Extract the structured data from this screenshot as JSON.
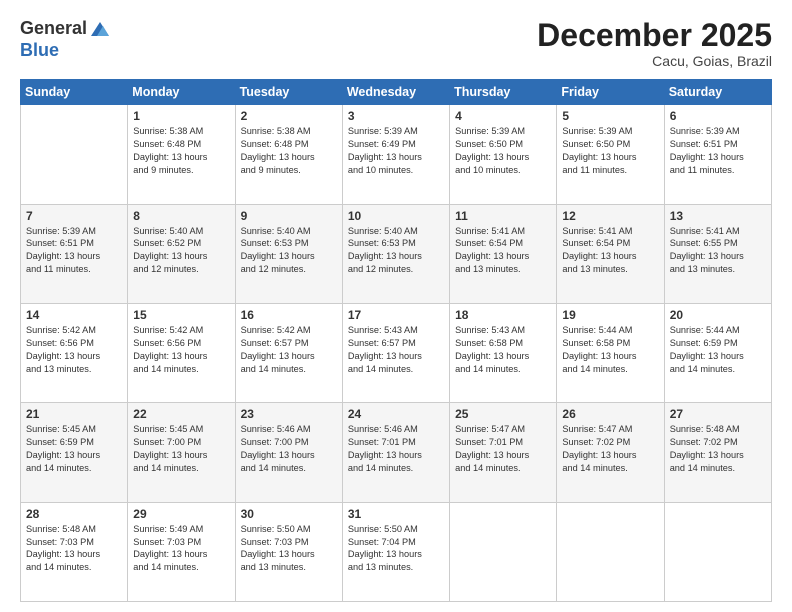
{
  "logo": {
    "general": "General",
    "blue": "Blue"
  },
  "title": "December 2025",
  "location": "Cacu, Goias, Brazil",
  "days_of_week": [
    "Sunday",
    "Monday",
    "Tuesday",
    "Wednesday",
    "Thursday",
    "Friday",
    "Saturday"
  ],
  "weeks": [
    [
      {
        "day": "",
        "info": ""
      },
      {
        "day": "1",
        "info": "Sunrise: 5:38 AM\nSunset: 6:48 PM\nDaylight: 13 hours\nand 9 minutes."
      },
      {
        "day": "2",
        "info": "Sunrise: 5:38 AM\nSunset: 6:48 PM\nDaylight: 13 hours\nand 9 minutes."
      },
      {
        "day": "3",
        "info": "Sunrise: 5:39 AM\nSunset: 6:49 PM\nDaylight: 13 hours\nand 10 minutes."
      },
      {
        "day": "4",
        "info": "Sunrise: 5:39 AM\nSunset: 6:50 PM\nDaylight: 13 hours\nand 10 minutes."
      },
      {
        "day": "5",
        "info": "Sunrise: 5:39 AM\nSunset: 6:50 PM\nDaylight: 13 hours\nand 11 minutes."
      },
      {
        "day": "6",
        "info": "Sunrise: 5:39 AM\nSunset: 6:51 PM\nDaylight: 13 hours\nand 11 minutes."
      }
    ],
    [
      {
        "day": "7",
        "info": "Sunrise: 5:39 AM\nSunset: 6:51 PM\nDaylight: 13 hours\nand 11 minutes."
      },
      {
        "day": "8",
        "info": "Sunrise: 5:40 AM\nSunset: 6:52 PM\nDaylight: 13 hours\nand 12 minutes."
      },
      {
        "day": "9",
        "info": "Sunrise: 5:40 AM\nSunset: 6:53 PM\nDaylight: 13 hours\nand 12 minutes."
      },
      {
        "day": "10",
        "info": "Sunrise: 5:40 AM\nSunset: 6:53 PM\nDaylight: 13 hours\nand 12 minutes."
      },
      {
        "day": "11",
        "info": "Sunrise: 5:41 AM\nSunset: 6:54 PM\nDaylight: 13 hours\nand 13 minutes."
      },
      {
        "day": "12",
        "info": "Sunrise: 5:41 AM\nSunset: 6:54 PM\nDaylight: 13 hours\nand 13 minutes."
      },
      {
        "day": "13",
        "info": "Sunrise: 5:41 AM\nSunset: 6:55 PM\nDaylight: 13 hours\nand 13 minutes."
      }
    ],
    [
      {
        "day": "14",
        "info": "Sunrise: 5:42 AM\nSunset: 6:56 PM\nDaylight: 13 hours\nand 13 minutes."
      },
      {
        "day": "15",
        "info": "Sunrise: 5:42 AM\nSunset: 6:56 PM\nDaylight: 13 hours\nand 14 minutes."
      },
      {
        "day": "16",
        "info": "Sunrise: 5:42 AM\nSunset: 6:57 PM\nDaylight: 13 hours\nand 14 minutes."
      },
      {
        "day": "17",
        "info": "Sunrise: 5:43 AM\nSunset: 6:57 PM\nDaylight: 13 hours\nand 14 minutes."
      },
      {
        "day": "18",
        "info": "Sunrise: 5:43 AM\nSunset: 6:58 PM\nDaylight: 13 hours\nand 14 minutes."
      },
      {
        "day": "19",
        "info": "Sunrise: 5:44 AM\nSunset: 6:58 PM\nDaylight: 13 hours\nand 14 minutes."
      },
      {
        "day": "20",
        "info": "Sunrise: 5:44 AM\nSunset: 6:59 PM\nDaylight: 13 hours\nand 14 minutes."
      }
    ],
    [
      {
        "day": "21",
        "info": "Sunrise: 5:45 AM\nSunset: 6:59 PM\nDaylight: 13 hours\nand 14 minutes."
      },
      {
        "day": "22",
        "info": "Sunrise: 5:45 AM\nSunset: 7:00 PM\nDaylight: 13 hours\nand 14 minutes."
      },
      {
        "day": "23",
        "info": "Sunrise: 5:46 AM\nSunset: 7:00 PM\nDaylight: 13 hours\nand 14 minutes."
      },
      {
        "day": "24",
        "info": "Sunrise: 5:46 AM\nSunset: 7:01 PM\nDaylight: 13 hours\nand 14 minutes."
      },
      {
        "day": "25",
        "info": "Sunrise: 5:47 AM\nSunset: 7:01 PM\nDaylight: 13 hours\nand 14 minutes."
      },
      {
        "day": "26",
        "info": "Sunrise: 5:47 AM\nSunset: 7:02 PM\nDaylight: 13 hours\nand 14 minutes."
      },
      {
        "day": "27",
        "info": "Sunrise: 5:48 AM\nSunset: 7:02 PM\nDaylight: 13 hours\nand 14 minutes."
      }
    ],
    [
      {
        "day": "28",
        "info": "Sunrise: 5:48 AM\nSunset: 7:03 PM\nDaylight: 13 hours\nand 14 minutes."
      },
      {
        "day": "29",
        "info": "Sunrise: 5:49 AM\nSunset: 7:03 PM\nDaylight: 13 hours\nand 14 minutes."
      },
      {
        "day": "30",
        "info": "Sunrise: 5:50 AM\nSunset: 7:03 PM\nDaylight: 13 hours\nand 13 minutes."
      },
      {
        "day": "31",
        "info": "Sunrise: 5:50 AM\nSunset: 7:04 PM\nDaylight: 13 hours\nand 13 minutes."
      },
      {
        "day": "",
        "info": ""
      },
      {
        "day": "",
        "info": ""
      },
      {
        "day": "",
        "info": ""
      }
    ]
  ]
}
